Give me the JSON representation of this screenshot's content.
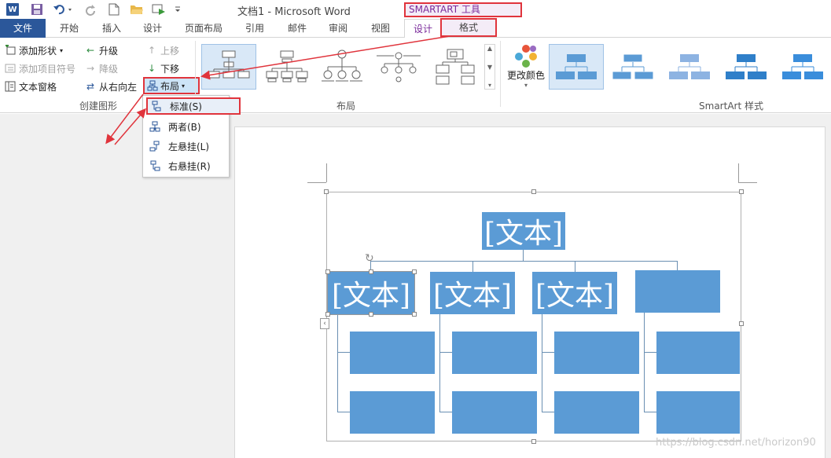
{
  "titlebar": {
    "document_title": "文档1 - Microsoft Word",
    "contextual_tools_label": "SMARTART 工具",
    "qat_icons": [
      "word-logo-icon",
      "save-icon",
      "undo-icon",
      "redo-icon",
      "new-document-icon",
      "open-folder-icon",
      "present-icon",
      "customize-qat-icon"
    ],
    "word_logo_letter": "W"
  },
  "tabs": [
    "文件",
    "开始",
    "插入",
    "设计",
    "页面布局",
    "引用",
    "邮件",
    "审阅",
    "视图",
    "设计",
    "格式"
  ],
  "ribbon": {
    "create_graphic": {
      "label": "创建图形",
      "add_shape": "添加形状",
      "add_bullet": "添加项目符号",
      "text_pane": "文本窗格",
      "promote": "升级",
      "demote": "降级",
      "right_to_left": "从右向左",
      "move_up": "上移",
      "move_down": "下移",
      "layout": "布局"
    },
    "layouts": {
      "label": "布局"
    },
    "styles": {
      "label": "SmartArt 样式",
      "change_colors": "更改颜色"
    }
  },
  "layout_menu": {
    "items": [
      {
        "label": "标准(S)",
        "icon": "standard-layout-icon"
      },
      {
        "label": "两者(B)",
        "icon": "both-layout-icon"
      },
      {
        "label": "左悬挂(L)",
        "icon": "left-hanging-icon"
      },
      {
        "label": "右悬挂(R)",
        "icon": "right-hanging-icon"
      }
    ]
  },
  "smartart": {
    "top_text": "[文本]",
    "child_texts": [
      "[文本]",
      "[文本]",
      "[文本]",
      ""
    ]
  },
  "colors": {
    "word_blue": "#2b579a",
    "smartart_fill": "#5b9bd5",
    "annotation_red": "#e0343c",
    "contextual_purple": "#7a2a9a"
  },
  "watermark": "https://blog.csdn.net/horizon90"
}
